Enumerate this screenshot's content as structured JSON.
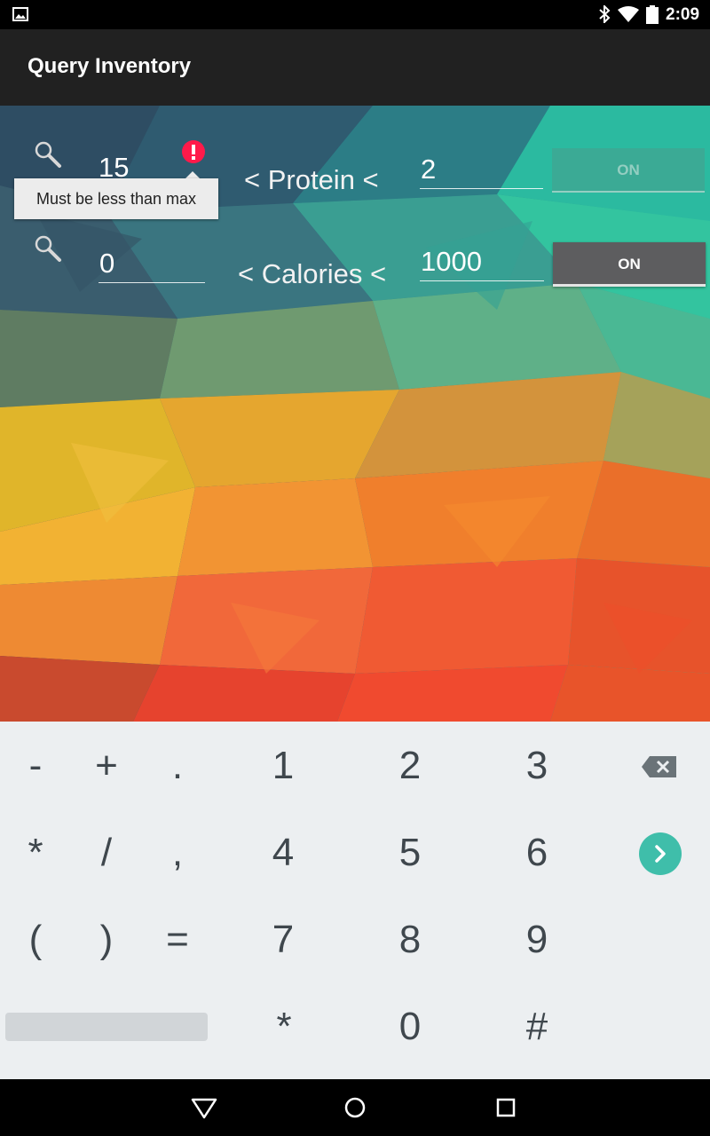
{
  "status_bar": {
    "time": "2:09"
  },
  "app_bar": {
    "title": "Query Inventory"
  },
  "filters": [
    {
      "min": "15",
      "label": "< Protein <",
      "max": "2",
      "toggle": "ON",
      "toggle_enabled": false,
      "error": "Must be less than max"
    },
    {
      "min": "0",
      "label": "< Calories <",
      "max": "1000",
      "toggle": "ON",
      "toggle_enabled": true
    }
  ],
  "keyboard": {
    "rows": [
      [
        "-",
        "+",
        ".",
        "1",
        "2",
        "3"
      ],
      [
        "*",
        "/",
        ",",
        "4",
        "5",
        "6"
      ],
      [
        "(",
        ")",
        "=",
        "7",
        "8",
        "9"
      ],
      [
        "*",
        "0",
        "#"
      ]
    ]
  },
  "colors": {
    "accent": "#3fbeaa",
    "error": "#ff1a4a",
    "app_bar": "#212121",
    "keyboard_bg": "#eceff1"
  },
  "icons": [
    "gallery-icon",
    "bluetooth-icon",
    "wifi-icon",
    "battery-icon",
    "search-icon",
    "error-icon",
    "backspace-icon",
    "next-icon",
    "back-icon",
    "home-icon",
    "recents-icon"
  ]
}
